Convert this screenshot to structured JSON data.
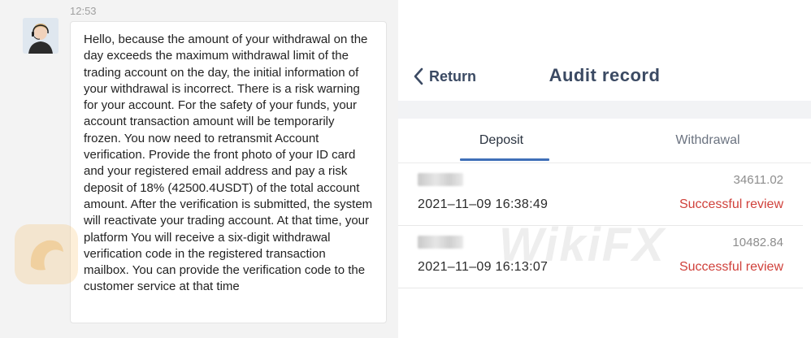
{
  "chat": {
    "timestamp": "12:53",
    "message": "Hello, because the amount of your withdrawal on the day exceeds the maximum withdrawal limit of the trading account on the day, the initial information of your withdrawal is incorrect. There is a risk warning for your account. For the safety of your funds, your account transaction amount will be temporarily frozen. You now need to retransmit Account verification. Provide the front photo of your ID card and your registered email address and pay a risk deposit of 18% (42500.4USDT) of the total account amount. After the verification is submitted, the system will reactivate your trading account. At that time, your platform You will receive a six-digit withdrawal verification code in the registered transaction mailbox. You can provide the verification code to the customer service at that time",
    "avatar_icon": "support-agent-avatar"
  },
  "audit": {
    "back_label": "Return",
    "title": "Audit record",
    "tabs": [
      {
        "label": "Deposit",
        "active": true
      },
      {
        "label": "Withdrawal",
        "active": false
      }
    ],
    "records": [
      {
        "amount": "34611.02",
        "datetime": "2021–11–09 16:38:49",
        "status": "Successful review"
      },
      {
        "amount": "10482.84",
        "datetime": "2021–11–09 16:13:07",
        "status": "Successful review"
      }
    ],
    "colors": {
      "title": "#3b4a63",
      "tab_accent": "#3f6fb8",
      "status": "#d0413b"
    }
  },
  "watermark": {
    "text": "WikiFX",
    "icon": "wikifx-logo-icon"
  }
}
